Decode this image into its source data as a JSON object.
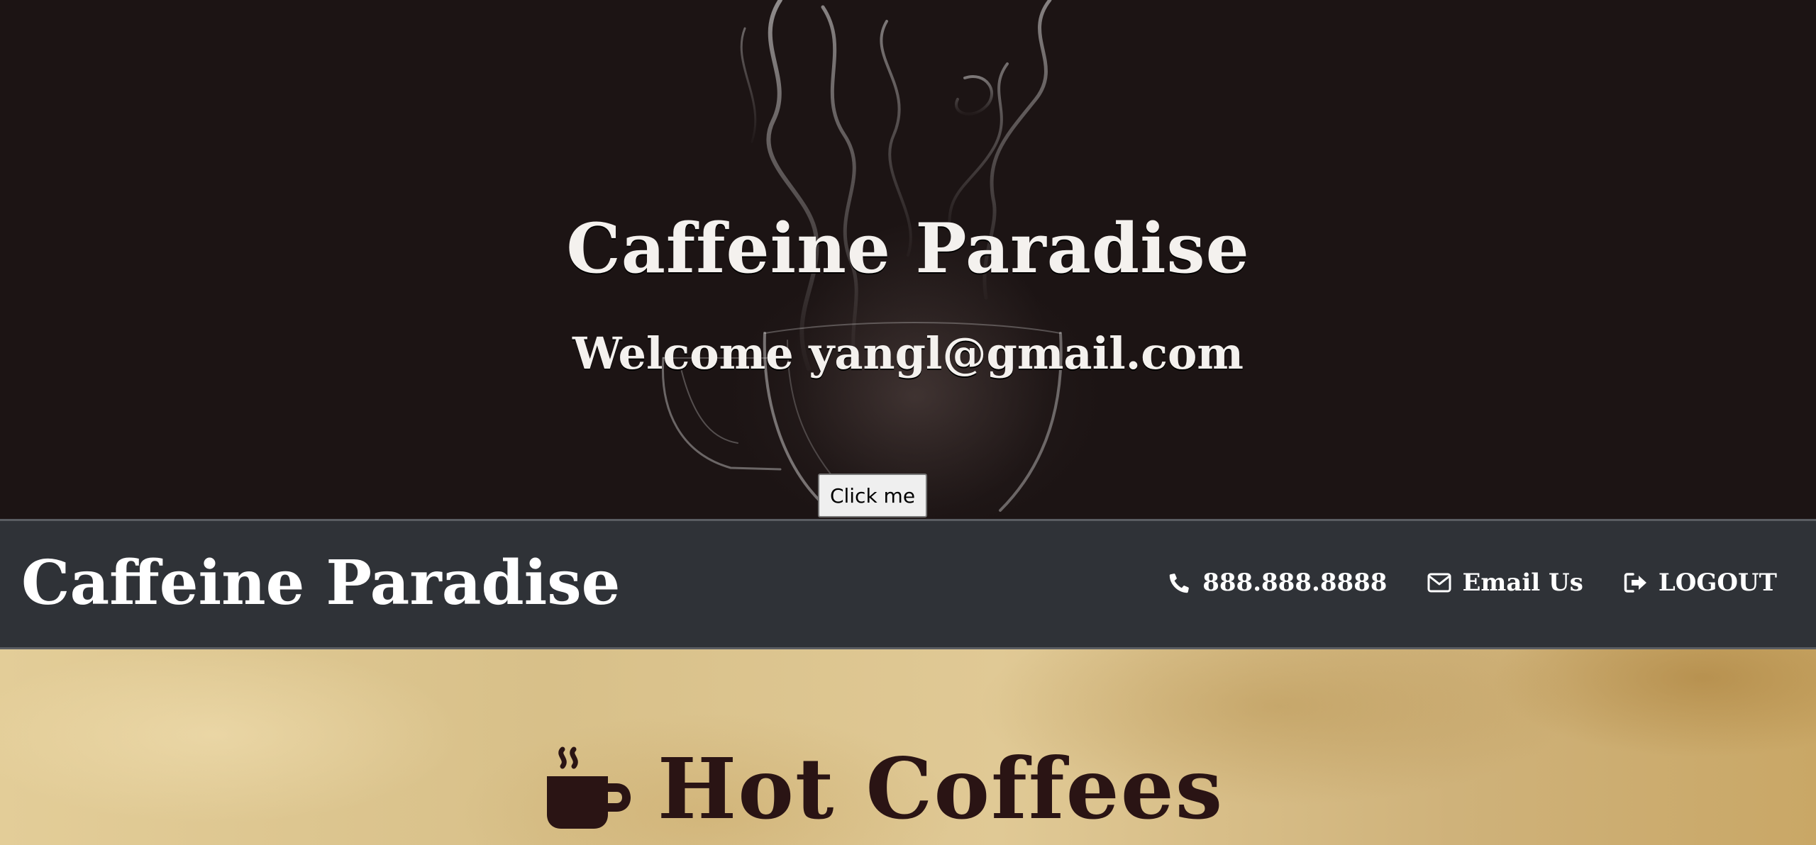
{
  "hero": {
    "title": "Caffeine Paradise",
    "subtitle": "Welcome yangl@gmail.com",
    "button_label": "Click me"
  },
  "navbar": {
    "brand": "Caffeine Paradise",
    "links": [
      {
        "icon": "phone-icon",
        "label": "888.888.8888"
      },
      {
        "icon": "envelope-icon",
        "label": "Email Us"
      },
      {
        "icon": "sign-out-icon",
        "label": "LOGOUT"
      }
    ]
  },
  "section": {
    "icon": "coffee-cup-icon",
    "title": "Hot Coffees"
  },
  "colors": {
    "hero_background": "#1c1414",
    "navbar_background": "#2f3237",
    "heading_text": "#2a1414",
    "light_text": "#f4f1ee"
  }
}
